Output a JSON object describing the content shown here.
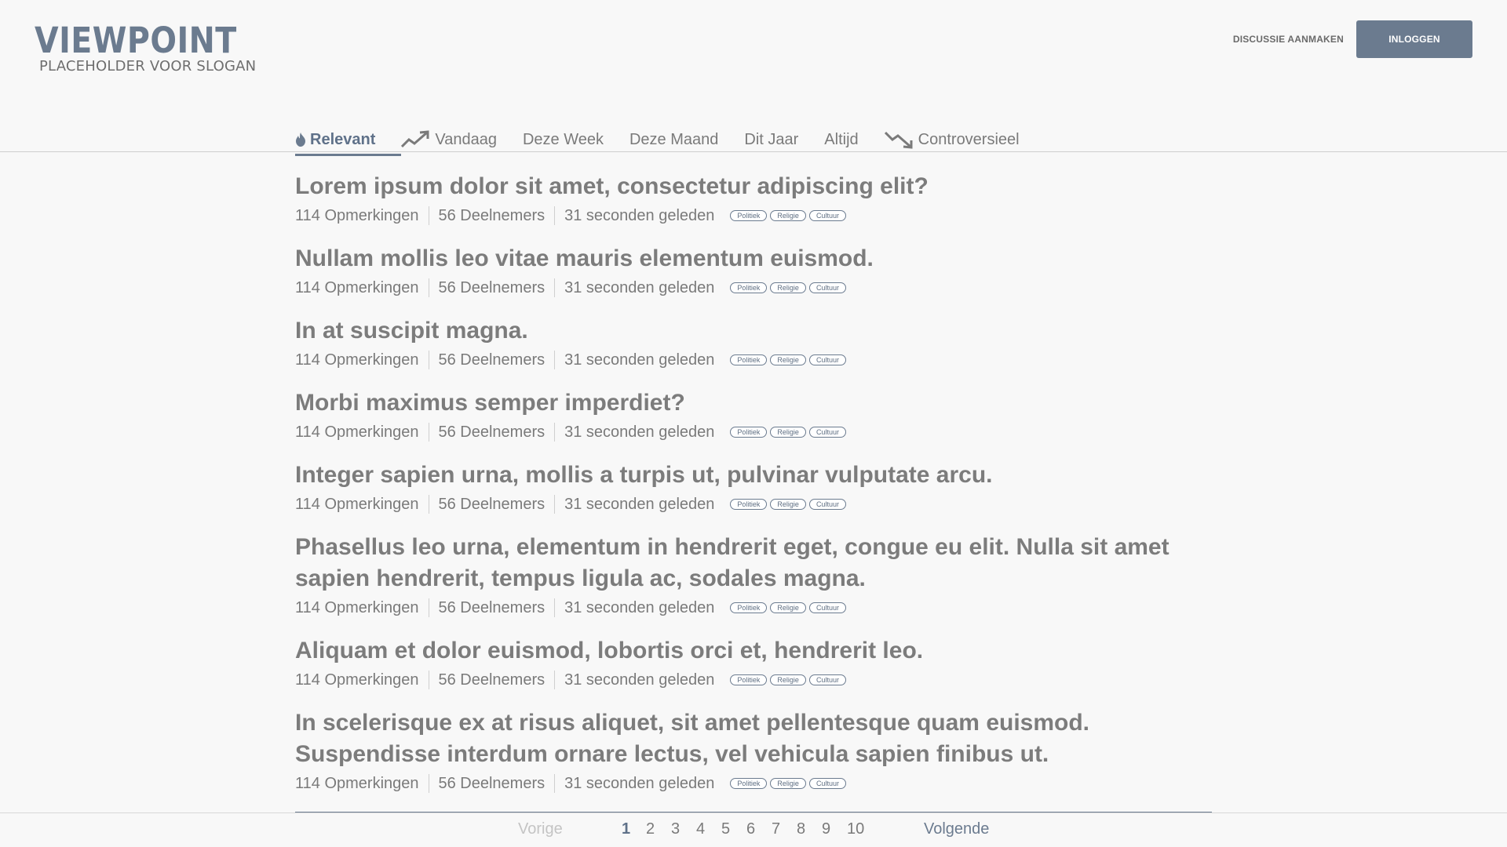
{
  "header": {
    "logo": "VIEWPOINT",
    "slogan": "PLACEHOLDER VOOR SLOGAN",
    "create_label": "DISCUSSIE AANMAKEN",
    "login_label": "INLOGGEN"
  },
  "tabs": [
    {
      "label": "Relevant",
      "icon": "flame-icon",
      "active": true
    },
    {
      "label": "Vandaag",
      "icon": "trending-up-icon"
    },
    {
      "label": "Deze Week"
    },
    {
      "label": "Deze Maand"
    },
    {
      "label": "Dit Jaar"
    },
    {
      "label": "Altijd"
    },
    {
      "label": "Controversieel",
      "icon": "trending-down-icon"
    }
  ],
  "discussions": [
    {
      "title": "Lorem ipsum dolor sit amet, consectetur adipiscing elit?",
      "comments": "114 Opmerkingen",
      "participants": "56 Deelnemers",
      "time": "31 seconden geleden",
      "tags": [
        "Politiek",
        "Religie",
        "Cultuur"
      ]
    },
    {
      "title": "Nullam mollis leo vitae mauris elementum euismod.",
      "comments": "114 Opmerkingen",
      "participants": "56 Deelnemers",
      "time": "31 seconden geleden",
      "tags": [
        "Politiek",
        "Religie",
        "Cultuur"
      ]
    },
    {
      "title": "In at suscipit magna.",
      "comments": "114 Opmerkingen",
      "participants": "56 Deelnemers",
      "time": "31 seconden geleden",
      "tags": [
        "Politiek",
        "Religie",
        "Cultuur"
      ]
    },
    {
      "title": "Morbi maximus semper imperdiet?",
      "comments": "114 Opmerkingen",
      "participants": "56 Deelnemers",
      "time": "31 seconden geleden",
      "tags": [
        "Politiek",
        "Religie",
        "Cultuur"
      ]
    },
    {
      "title": "Integer sapien urna, mollis a turpis ut, pulvinar vulputate arcu.",
      "comments": "114 Opmerkingen",
      "participants": "56 Deelnemers",
      "time": "31 seconden geleden",
      "tags": [
        "Politiek",
        "Religie",
        "Cultuur"
      ]
    },
    {
      "title": "Phasellus leo urna, elementum in hendrerit eget, congue eu elit. Nulla sit amet sapien hendrerit, tempus ligula ac, sodales magna.",
      "comments": "114 Opmerkingen",
      "participants": "56 Deelnemers",
      "time": "31 seconden geleden",
      "tags": [
        "Politiek",
        "Religie",
        "Cultuur"
      ]
    },
    {
      "title": "Aliquam et dolor euismod, lobortis orci et, hendrerit leo.",
      "comments": "114 Opmerkingen",
      "participants": "56 Deelnemers",
      "time": "31 seconden geleden",
      "tags": [
        "Politiek",
        "Religie",
        "Cultuur"
      ]
    },
    {
      "title": "In scelerisque ex at risus aliquet, sit amet pellentesque quam euismod. Suspendisse interdum ornare lectus, vel vehicula sapien finibus ut.",
      "comments": "114 Opmerkingen",
      "participants": "56 Deelnemers",
      "time": "31 seconden geleden",
      "tags": [
        "Politiek",
        "Religie",
        "Cultuur"
      ]
    }
  ],
  "pagination": {
    "prev": "Vorige",
    "next": "Volgende",
    "pages": [
      "1",
      "2",
      "3",
      "4",
      "5",
      "6",
      "7",
      "8",
      "9",
      "10"
    ],
    "current": "1"
  },
  "colors": {
    "accent": "#6b7b8f",
    "background": "#f8f8f8",
    "text": "#7a7a7a"
  }
}
